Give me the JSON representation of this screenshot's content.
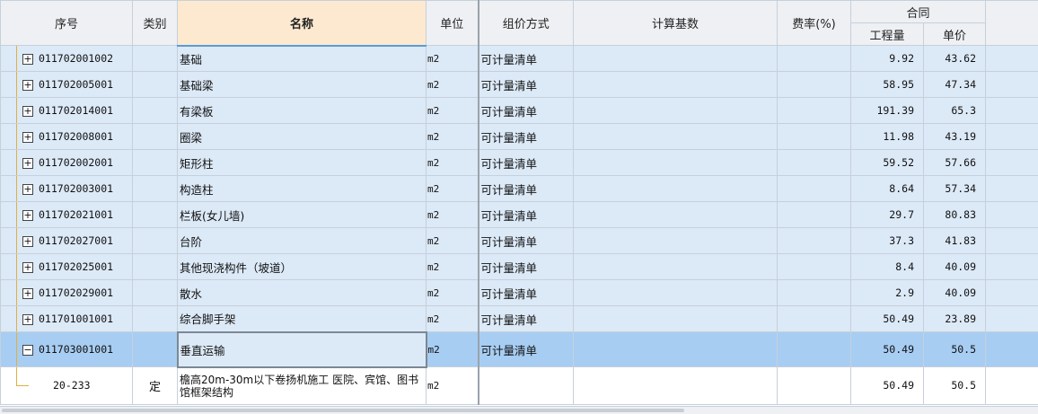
{
  "headers": {
    "seq": "序号",
    "category": "类别",
    "name": "名称",
    "unit": "单位",
    "method": "组价方式",
    "base": "计算基数",
    "rate": "费率(%)",
    "contract": "合同",
    "quantity": "工程量",
    "price": "单价"
  },
  "rows": [
    {
      "seq": "011702001002",
      "name": "基础",
      "unit": "m2",
      "method": "可计量清单",
      "qty": "9.92",
      "price": "43.62"
    },
    {
      "seq": "011702005001",
      "name": "基础梁",
      "unit": "m2",
      "method": "可计量清单",
      "qty": "58.95",
      "price": "47.34"
    },
    {
      "seq": "011702014001",
      "name": "有梁板",
      "unit": "m2",
      "method": "可计量清单",
      "qty": "191.39",
      "price": "65.3"
    },
    {
      "seq": "011702008001",
      "name": "圈梁",
      "unit": "m2",
      "method": "可计量清单",
      "qty": "11.98",
      "price": "43.19"
    },
    {
      "seq": "011702002001",
      "name": "矩形柱",
      "unit": "m2",
      "method": "可计量清单",
      "qty": "59.52",
      "price": "57.66"
    },
    {
      "seq": "011702003001",
      "name": "构造柱",
      "unit": "m2",
      "method": "可计量清单",
      "qty": "8.64",
      "price": "57.34"
    },
    {
      "seq": "011702021001",
      "name": "栏板(女儿墙)",
      "unit": "m2",
      "method": "可计量清单",
      "qty": "29.7",
      "price": "80.83"
    },
    {
      "seq": "011702027001",
      "name": "台阶",
      "unit": "m2",
      "method": "可计量清单",
      "qty": "37.3",
      "price": "41.83"
    },
    {
      "seq": "011702025001",
      "name": "其他现浇构件（坡道）",
      "unit": "m2",
      "method": "可计量清单",
      "qty": "8.4",
      "price": "40.09"
    },
    {
      "seq": "011702029001",
      "name": "散水",
      "unit": "m2",
      "method": "可计量清单",
      "qty": "2.9",
      "price": "40.09"
    },
    {
      "seq": "011701001001",
      "name": "综合脚手架",
      "unit": "m2",
      "method": "可计量清单",
      "qty": "50.49",
      "price": "23.89"
    }
  ],
  "selected_row": {
    "seq": "011703001001",
    "name": "垂直运输",
    "unit": "m2",
    "method": "可计量清单",
    "qty": "50.49",
    "price": "50.5"
  },
  "sub_row": {
    "seq": "20-233",
    "category": "定",
    "name": "檐高20m-30m以下卷扬机施工 医院、宾馆、图书馆框架结构",
    "unit": "m2",
    "qty": "50.49",
    "price": "50.5"
  },
  "icons": {
    "expand": "+",
    "collapse": "−"
  }
}
